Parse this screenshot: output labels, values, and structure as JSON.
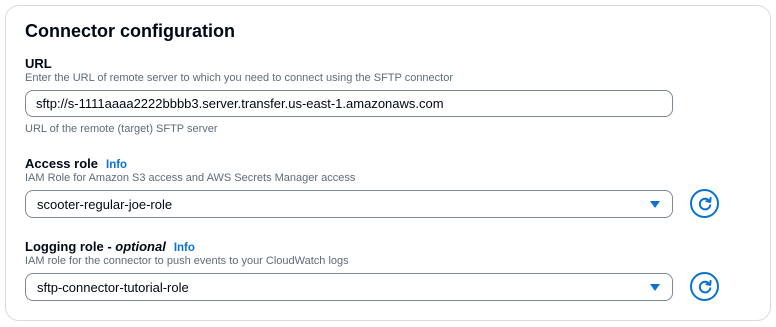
{
  "panel": {
    "title": "Connector configuration"
  },
  "url_field": {
    "label": "URL",
    "description": "Enter the URL of remote server to which you need to connect using the SFTP connector",
    "value": "sftp://s-1111aaaa2222bbbb3.server.transfer.us-east-1.amazonaws.com",
    "constraint": "URL of the remote (target) SFTP server"
  },
  "access_role": {
    "label": "Access role",
    "info": "Info",
    "description": "IAM Role for Amazon S3 access and AWS Secrets Manager access",
    "selected": "scooter-regular-joe-role",
    "refresh_icon": "refresh-icon"
  },
  "logging_role": {
    "label": "Logging role - ",
    "label_optional": "optional",
    "info": "Info",
    "description": "IAM role for the connector to push events to your CloudWatch logs",
    "selected": "sftp-connector-tutorial-role",
    "refresh_icon": "refresh-icon"
  },
  "colors": {
    "accent": "#0972d3",
    "text": "#000716",
    "muted": "#5f6b7a",
    "border": "#7d8998"
  }
}
